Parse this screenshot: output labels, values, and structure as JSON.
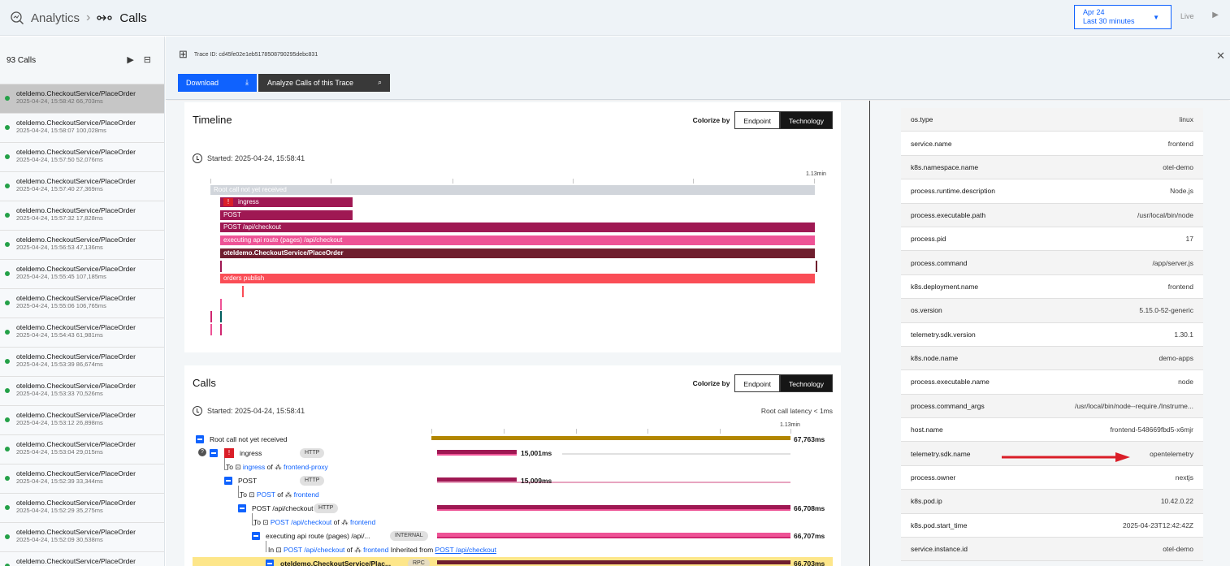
{
  "topbar": {
    "analytics": "Analytics",
    "calls": "Calls",
    "date_line1": "Apr 24",
    "date_line2": "Last 30 minutes",
    "live": "Live"
  },
  "left_panel": {
    "count": "93 Calls",
    "calls": [
      {
        "name": "oteldemo.CheckoutService/PlaceOrder",
        "meta": "2025-04-24, 15:58:42  66,703ms",
        "selected": true
      },
      {
        "name": "oteldemo.CheckoutService/PlaceOrder",
        "meta": "2025-04-24, 15:58:07  100,028ms"
      },
      {
        "name": "oteldemo.CheckoutService/PlaceOrder",
        "meta": "2025-04-24, 15:57:50  52,076ms"
      },
      {
        "name": "oteldemo.CheckoutService/PlaceOrder",
        "meta": "2025-04-24, 15:57:40  27,369ms"
      },
      {
        "name": "oteldemo.CheckoutService/PlaceOrder",
        "meta": "2025-04-24, 15:57:32  17,828ms"
      },
      {
        "name": "oteldemo.CheckoutService/PlaceOrder",
        "meta": "2025-04-24, 15:56:53  47,136ms"
      },
      {
        "name": "oteldemo.CheckoutService/PlaceOrder",
        "meta": "2025-04-24, 15:55:45  107,185ms"
      },
      {
        "name": "oteldemo.CheckoutService/PlaceOrder",
        "meta": "2025-04-24, 15:55:06  106,765ms"
      },
      {
        "name": "oteldemo.CheckoutService/PlaceOrder",
        "meta": "2025-04-24, 15:54:43  61,981ms"
      },
      {
        "name": "oteldemo.CheckoutService/PlaceOrder",
        "meta": "2025-04-24, 15:53:39  86,674ms"
      },
      {
        "name": "oteldemo.CheckoutService/PlaceOrder",
        "meta": "2025-04-24, 15:53:33  70,526ms"
      },
      {
        "name": "oteldemo.CheckoutService/PlaceOrder",
        "meta": "2025-04-24, 15:53:12  26,898ms"
      },
      {
        "name": "oteldemo.CheckoutService/PlaceOrder",
        "meta": "2025-04-24, 15:53:04  29,015ms"
      },
      {
        "name": "oteldemo.CheckoutService/PlaceOrder",
        "meta": "2025-04-24, 15:52:39  33,344ms"
      },
      {
        "name": "oteldemo.CheckoutService/PlaceOrder",
        "meta": "2025-04-24, 15:52:29  35,275ms"
      },
      {
        "name": "oteldemo.CheckoutService/PlaceOrder",
        "meta": "2025-04-24, 15:52:09  30,538ms"
      },
      {
        "name": "oteldemo.CheckoutService/PlaceOrder",
        "meta": ""
      }
    ]
  },
  "trace": {
    "id": "Trace ID: cd45fe02e1eb5178508790295debc831",
    "download": "Download",
    "analyze": "Analyze Calls of this Trace"
  },
  "timeline": {
    "title": "Timeline",
    "colorize": "Colorize by",
    "opt_endpoint": "Endpoint",
    "opt_technology": "Technology",
    "started": "Started: 2025-04-24, 15:58:41",
    "scale": "1.13min",
    "bars": {
      "root": "Root call not yet received",
      "ingress": "ingress",
      "post": "POST",
      "post_checkout": "POST /api/checkout",
      "exec": "executing api route (pages) /api/checkout",
      "placeorder": "oteldemo.CheckoutService/PlaceOrder",
      "orders": "orders publish"
    }
  },
  "calls_section": {
    "title": "Calls",
    "colorize": "Colorize by",
    "opt_endpoint": "Endpoint",
    "opt_technology": "Technology",
    "started": "Started: 2025-04-24, 15:58:41",
    "latency": "Root call latency < 1ms",
    "scale": "1.13min",
    "rows": {
      "root": {
        "label": "Root call not yet received",
        "ms": "67,763ms"
      },
      "ingress": {
        "label": "ingress",
        "tag": "HTTP",
        "ms": "15,001ms"
      },
      "ingress_to": {
        "to": "To",
        "ep": "ingress",
        "of": "of",
        "svc": "frontend-proxy"
      },
      "post": {
        "label": "POST",
        "tag": "HTTP",
        "ms": "15,009ms"
      },
      "post_to": {
        "to": "To",
        "ep": "POST",
        "of": "of",
        "svc": "frontend"
      },
      "pc": {
        "label": "POST /api/checkout",
        "tag": "HTTP",
        "ms": "66,708ms"
      },
      "pc_to": {
        "to": "To",
        "ep": "POST /api/checkout",
        "of": "of",
        "svc": "frontend"
      },
      "exec": {
        "label": "executing api route (pages) /api/...",
        "tag": "INTERNAL",
        "ms": "66,707ms"
      },
      "exec_in": {
        "in": "In",
        "ep": "POST /api/checkout",
        "of": "of",
        "svc": "frontend",
        "inh": "Inherited from",
        "inh_ep": "POST /api/checkout"
      },
      "place": {
        "label": "oteldemo.CheckoutService/Plac...",
        "tag": "RPC",
        "ms": "66,703ms"
      }
    }
  },
  "attributes": [
    {
      "k": "os.type",
      "v": "linux"
    },
    {
      "k": "service.name",
      "v": "frontend"
    },
    {
      "k": "k8s.namespace.name",
      "v": "otel-demo"
    },
    {
      "k": "process.runtime.description",
      "v": "Node.js"
    },
    {
      "k": "process.executable.path",
      "v": "/usr/local/bin/node"
    },
    {
      "k": "process.pid",
      "v": "17"
    },
    {
      "k": "process.command",
      "v": "/app/server.js"
    },
    {
      "k": "k8s.deployment.name",
      "v": "frontend"
    },
    {
      "k": "os.version",
      "v": "5.15.0-52-generic"
    },
    {
      "k": "telemetry.sdk.version",
      "v": "1.30.1"
    },
    {
      "k": "k8s.node.name",
      "v": "demo-apps"
    },
    {
      "k": "process.executable.name",
      "v": "node"
    },
    {
      "k": "process.command_args",
      "v": "/usr/local/bin/node--require./Instrume..."
    },
    {
      "k": "host.name",
      "v": "frontend-548669fbd5-x6mjr"
    },
    {
      "k": "telemetry.sdk.name",
      "v": "opentelemetry"
    },
    {
      "k": "process.owner",
      "v": "nextjs"
    },
    {
      "k": "k8s.pod.ip",
      "v": "10.42.0.22"
    },
    {
      "k": "k8s.pod.start_time",
      "v": "2025-04-23T12:42:42Z"
    },
    {
      "k": "service.instance.id",
      "v": "otel-demo"
    }
  ],
  "colors": {
    "accent": "#0f62fe",
    "span_dark": "#9f1853",
    "span_mid": "#d02670",
    "span_pink": "#ee5396",
    "span_red": "#fa4d56",
    "root_gold": "#b28600",
    "arrow": "#da1e28"
  }
}
